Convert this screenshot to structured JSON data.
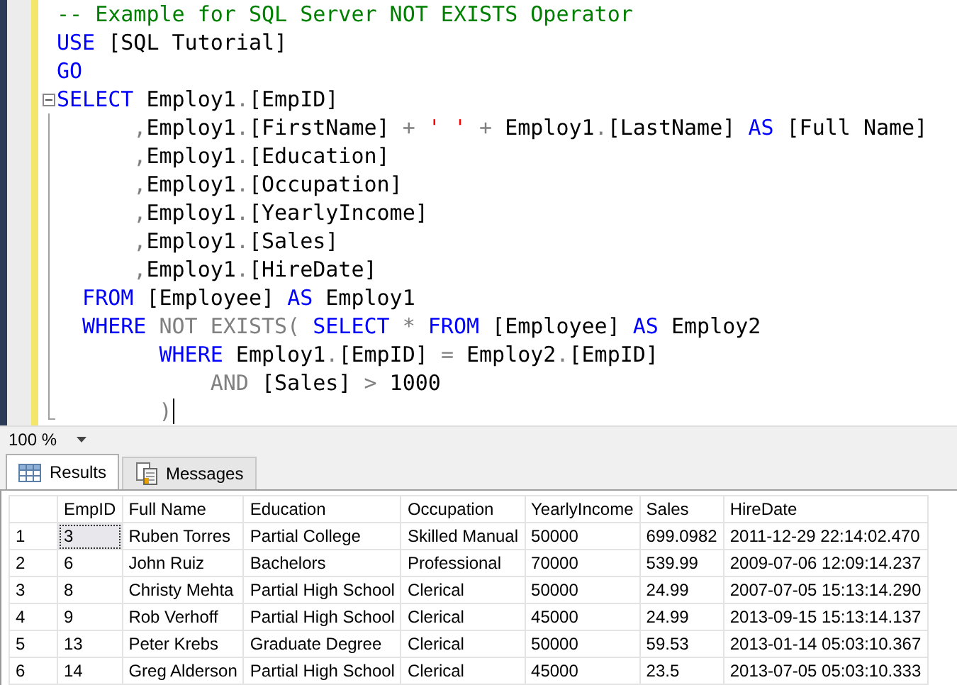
{
  "editor": {
    "lines": [
      {
        "kind": "plain",
        "tokens": [
          {
            "kind": "comment",
            "text": "-- Example for SQL Server NOT EXISTS Operator"
          }
        ]
      },
      {
        "kind": "plain",
        "tokens": [
          {
            "kind": "keyword",
            "text": "USE"
          },
          {
            "kind": "text",
            "text": " [SQL Tutorial]"
          }
        ]
      },
      {
        "kind": "plain",
        "tokens": [
          {
            "kind": "keyword",
            "text": "GO"
          }
        ]
      },
      {
        "kind": "header",
        "tokens": [
          {
            "kind": "keyword",
            "text": "SELECT"
          },
          {
            "kind": "text",
            "text": " Employ1"
          },
          {
            "kind": "operator",
            "text": "."
          },
          {
            "kind": "text",
            "text": "[EmpID]"
          }
        ]
      },
      {
        "kind": "body",
        "tokens": [
          {
            "kind": "operator",
            "text": "      ,"
          },
          {
            "kind": "text",
            "text": "Employ1"
          },
          {
            "kind": "operator",
            "text": "."
          },
          {
            "kind": "text",
            "text": "[FirstName] "
          },
          {
            "kind": "operator",
            "text": "+"
          },
          {
            "kind": "string",
            "text": " ' ' "
          },
          {
            "kind": "operator",
            "text": "+"
          },
          {
            "kind": "text",
            "text": " Employ1"
          },
          {
            "kind": "operator",
            "text": "."
          },
          {
            "kind": "text",
            "text": "[LastName] "
          },
          {
            "kind": "keyword",
            "text": "AS"
          },
          {
            "kind": "text",
            "text": " [Full Name]"
          }
        ]
      },
      {
        "kind": "body",
        "tokens": [
          {
            "kind": "operator",
            "text": "      ,"
          },
          {
            "kind": "text",
            "text": "Employ1"
          },
          {
            "kind": "operator",
            "text": "."
          },
          {
            "kind": "text",
            "text": "[Education]"
          }
        ]
      },
      {
        "kind": "body",
        "tokens": [
          {
            "kind": "operator",
            "text": "      ,"
          },
          {
            "kind": "text",
            "text": "Employ1"
          },
          {
            "kind": "operator",
            "text": "."
          },
          {
            "kind": "text",
            "text": "[Occupation]"
          }
        ]
      },
      {
        "kind": "body",
        "tokens": [
          {
            "kind": "operator",
            "text": "      ,"
          },
          {
            "kind": "text",
            "text": "Employ1"
          },
          {
            "kind": "operator",
            "text": "."
          },
          {
            "kind": "text",
            "text": "[YearlyIncome]"
          }
        ]
      },
      {
        "kind": "body",
        "tokens": [
          {
            "kind": "operator",
            "text": "      ,"
          },
          {
            "kind": "text",
            "text": "Employ1"
          },
          {
            "kind": "operator",
            "text": "."
          },
          {
            "kind": "text",
            "text": "[Sales]"
          }
        ]
      },
      {
        "kind": "body",
        "tokens": [
          {
            "kind": "operator",
            "text": "      ,"
          },
          {
            "kind": "text",
            "text": "Employ1"
          },
          {
            "kind": "operator",
            "text": "."
          },
          {
            "kind": "text",
            "text": "[HireDate]"
          }
        ]
      },
      {
        "kind": "body",
        "tokens": [
          {
            "kind": "keyword",
            "text": "  FROM"
          },
          {
            "kind": "text",
            "text": " [Employee] "
          },
          {
            "kind": "keyword",
            "text": "AS"
          },
          {
            "kind": "text",
            "text": " Employ1"
          }
        ]
      },
      {
        "kind": "body",
        "tokens": [
          {
            "kind": "keyword",
            "text": "  WHERE"
          },
          {
            "kind": "operator",
            "text": " NOT EXISTS( "
          },
          {
            "kind": "keyword",
            "text": "SELECT"
          },
          {
            "kind": "operator",
            "text": " * "
          },
          {
            "kind": "keyword",
            "text": "FROM"
          },
          {
            "kind": "text",
            "text": " [Employee] "
          },
          {
            "kind": "keyword",
            "text": "AS"
          },
          {
            "kind": "text",
            "text": " Employ2"
          }
        ]
      },
      {
        "kind": "body",
        "tokens": [
          {
            "kind": "keyword",
            "text": "        WHERE"
          },
          {
            "kind": "text",
            "text": " Employ1"
          },
          {
            "kind": "operator",
            "text": "."
          },
          {
            "kind": "text",
            "text": "[EmpID] "
          },
          {
            "kind": "operator",
            "text": "="
          },
          {
            "kind": "text",
            "text": " Employ2"
          },
          {
            "kind": "operator",
            "text": "."
          },
          {
            "kind": "text",
            "text": "[EmpID]"
          }
        ]
      },
      {
        "kind": "body",
        "tokens": [
          {
            "kind": "operator",
            "text": "            AND"
          },
          {
            "kind": "text",
            "text": " [Sales] "
          },
          {
            "kind": "operator",
            "text": ">"
          },
          {
            "kind": "text",
            "text": " 1000"
          }
        ]
      },
      {
        "kind": "footer",
        "caret": true,
        "tokens": [
          {
            "kind": "operator",
            "text": "        )"
          }
        ]
      }
    ]
  },
  "zoom": {
    "value": "100 %"
  },
  "tabs": [
    {
      "label": "Results",
      "selected": true
    },
    {
      "label": "Messages",
      "selected": false
    }
  ],
  "grid": {
    "columns": [
      "EmpID",
      "Full Name",
      "Education",
      "Occupation",
      "YearlyIncome",
      "Sales",
      "HireDate"
    ],
    "rows": [
      {
        "number": "1",
        "selected": true,
        "cells": [
          "3",
          "Ruben Torres",
          "Partial College",
          "Skilled Manual",
          "50000",
          "699.0982",
          "2011-12-29 22:14:02.470"
        ]
      },
      {
        "number": "2",
        "selected": false,
        "cells": [
          "6",
          "John Ruiz",
          "Bachelors",
          "Professional",
          "70000",
          "539.99",
          "2009-07-06 12:09:14.237"
        ]
      },
      {
        "number": "3",
        "selected": false,
        "cells": [
          "8",
          "Christy Mehta",
          "Partial High School",
          "Clerical",
          "50000",
          "24.99",
          "2007-07-05 15:13:14.290"
        ]
      },
      {
        "number": "4",
        "selected": false,
        "cells": [
          "9",
          "Rob Verhoff",
          "Partial High School",
          "Clerical",
          "45000",
          "24.99",
          "2013-09-15 15:13:14.137"
        ]
      },
      {
        "number": "5",
        "selected": false,
        "cells": [
          "13",
          "Peter Krebs",
          "Graduate Degree",
          "Clerical",
          "50000",
          "59.53",
          "2013-01-14 05:03:10.367"
        ]
      },
      {
        "number": "6",
        "selected": false,
        "cells": [
          "14",
          "Greg Alderson",
          "Partial High School",
          "Clerical",
          "45000",
          "23.5",
          "2013-07-05 05:03:10.333"
        ]
      }
    ]
  }
}
